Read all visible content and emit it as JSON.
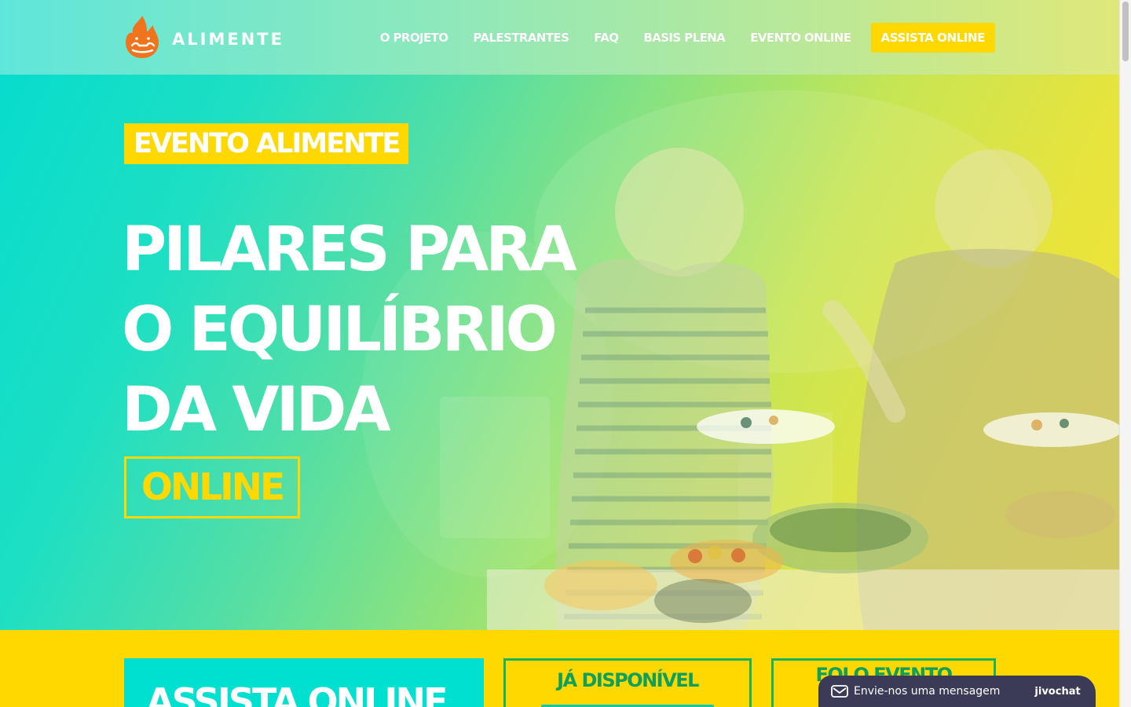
{
  "header": {
    "logo_text": "ALIMENTE",
    "nav": [
      {
        "label": "O PROJETO"
      },
      {
        "label": "PALESTRANTES"
      },
      {
        "label": "FAQ"
      },
      {
        "label": "BASIS PLENA"
      },
      {
        "label": "EVENTO ONLINE"
      }
    ],
    "cta_label": "ASSISTA ONLINE"
  },
  "hero": {
    "badge": "EVENTO ALIMENTE",
    "title_lines": [
      "PILARES PARA",
      "O EQUILÍBRIO",
      "DA VIDA"
    ],
    "online_label": "ONLINE"
  },
  "cards": {
    "watch_title": "ASSISTA ONLINE",
    "available_title": "JÁ DISPONÍVEL",
    "events_title": "FOI O EVENTO"
  },
  "chat": {
    "message": "Envie-nos uma mensagem",
    "brand": "jivochat",
    "icon": "envelope-icon"
  },
  "colors": {
    "brand_yellow": "#ffd800",
    "brand_teal": "#00e0d0",
    "brand_green": "#17b45c",
    "chat_bg": "#3c3b57"
  }
}
